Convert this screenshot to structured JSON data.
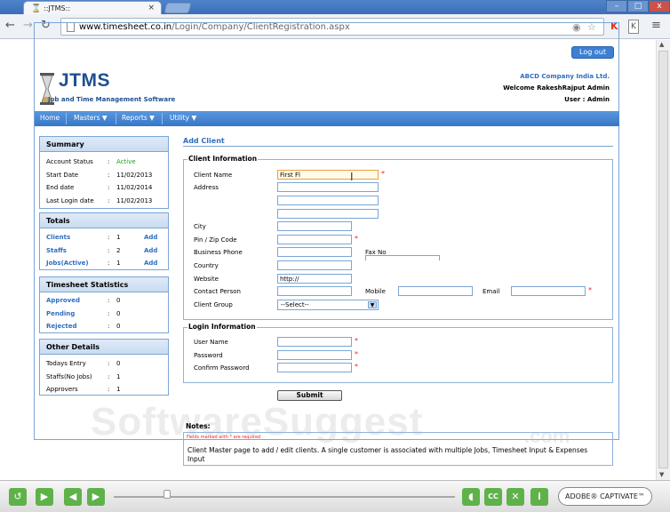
{
  "browser": {
    "tab_title": "::JTMS::",
    "tab_close": "×",
    "url_domain": "www.timesheet.co.in",
    "url_path": "/Login/Company/ClientRegistration.aspx",
    "window_buttons": [
      "–",
      "□",
      "x"
    ]
  },
  "page": {
    "logout_label": "Log out",
    "logo_title": "JTMS",
    "logo_subtitle": "Job and Time Management Software",
    "company": "ABCD Company India Ltd.",
    "welcome": "Welcome RakeshRajput Admin",
    "user_line": "User : Admin",
    "nav": [
      "Home",
      "Masters ▼",
      "Reports ▼",
      "Utility ▼"
    ]
  },
  "sidebar": {
    "summary": {
      "title": "Summary",
      "rows": [
        {
          "label": "Account Status",
          "value": "Active"
        },
        {
          "label": "Start Date",
          "value": "11/02/2013"
        },
        {
          "label": "End date",
          "value": "11/02/2014"
        },
        {
          "label": "Last Login date",
          "value": "11/02/2013"
        }
      ]
    },
    "totals": {
      "title": "Totals",
      "rows": [
        {
          "label": "Clients",
          "value": "1",
          "action": "Add"
        },
        {
          "label": "Staffs",
          "value": "2",
          "action": "Add"
        },
        {
          "label": "Jobs(Active)",
          "value": "1",
          "action": "Add"
        }
      ]
    },
    "timesheet": {
      "title": "Timesheet Statistics",
      "rows": [
        {
          "label": "Approved",
          "value": "0"
        },
        {
          "label": "Pending",
          "value": "0"
        },
        {
          "label": "Rejected",
          "value": "0"
        }
      ]
    },
    "other": {
      "title": "Other Details",
      "rows": [
        {
          "label": "Todays Entry",
          "value": "0"
        },
        {
          "label": "Staffs(No Jobs)",
          "value": "1"
        },
        {
          "label": "Approvers",
          "value": "1"
        }
      ]
    },
    "colon": ":"
  },
  "form": {
    "heading": "Add Client",
    "client_info_legend": "Client Information",
    "client_name_label": "Client Name",
    "client_name_value": "First Fl",
    "address_label": "Address",
    "city_label": "City",
    "pin_label": "Pin / Zip Code",
    "phone_label": "Business Phone",
    "fax_label": "Fax No",
    "country_label": "Country",
    "website_label": "Website",
    "website_value": "http://",
    "contact_label": "Contact Person",
    "mobile_label": "Mobile",
    "email_label": "Email",
    "group_label": "Client Group",
    "group_value": "--Select--",
    "login_info_legend": "Login Information",
    "username_label": "User Name",
    "password_label": "Password",
    "confirm_label": "Confirm Password",
    "submit_label": "Submit",
    "required_mark": "*"
  },
  "notes": {
    "title": "Notes:",
    "required_note": "Fields marked with * are required",
    "text": "Client Master page to add / edit clients. A single customer is associated with multiple Jobs, Timesheet Input & Expenses Input"
  },
  "watermark": {
    "main": "SoftwareSuggest",
    "suffix": ".com"
  },
  "player": {
    "brand": "ADOBE® CAPTIVATE™"
  },
  "colors": {
    "accent": "#2f6ec0",
    "nav": "#3677c7",
    "required": "#ee2222",
    "player_green": "#5fb24a"
  }
}
